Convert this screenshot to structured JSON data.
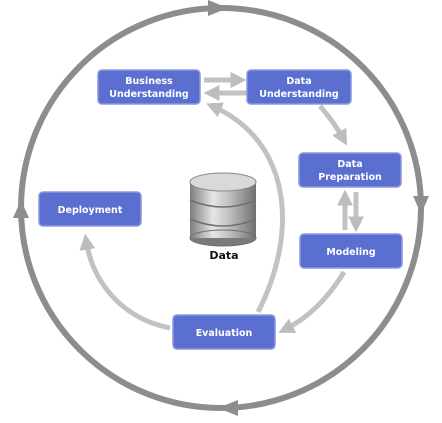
{
  "diagram": {
    "center_label": "Data",
    "center_icon": "database-cylinder-icon",
    "nodes": [
      {
        "id": "business-understanding",
        "lines": [
          "Business",
          "Understanding"
        ]
      },
      {
        "id": "data-understanding",
        "lines": [
          "Data",
          "Understanding"
        ]
      },
      {
        "id": "data-preparation",
        "lines": [
          "Data",
          "Preparation"
        ]
      },
      {
        "id": "modeling",
        "lines": [
          "Modeling"
        ]
      },
      {
        "id": "evaluation",
        "lines": [
          "Evaluation"
        ]
      },
      {
        "id": "deployment",
        "lines": [
          "Deployment"
        ]
      }
    ]
  },
  "colors": {
    "node_fill": "#5b6fd0",
    "node_stroke": "#8a99e0",
    "node_text": "#ffffff",
    "outer_ring": "#8d8d8d",
    "inner_arrows": "#c2c2c2",
    "label": "#111111"
  }
}
